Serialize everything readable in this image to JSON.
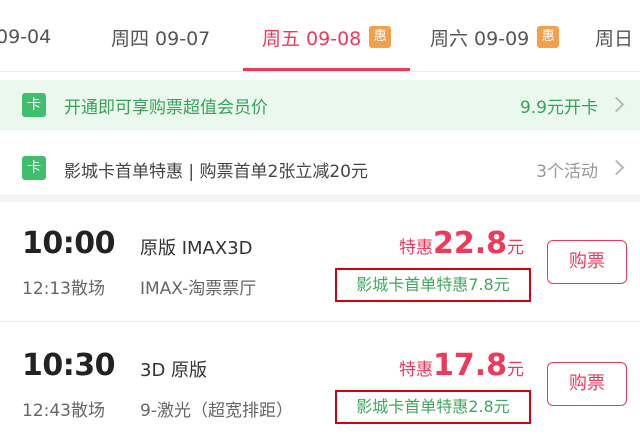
{
  "date_tabs": [
    {
      "label": "09-04",
      "badge": ""
    },
    {
      "label": "周四 09-07",
      "badge": ""
    },
    {
      "label": "周五 09-08",
      "badge": "惠"
    },
    {
      "label": "周六 09-09",
      "badge": "惠"
    },
    {
      "label": "周日",
      "badge": ""
    }
  ],
  "active_tab_index": 2,
  "colors": {
    "accent": "#f0395a",
    "green": "#3fbf6e",
    "badge": "#f2a14a",
    "highlight_box": "#d8000f"
  },
  "promos": [
    {
      "icon_label": "卡",
      "icon": "card-icon",
      "text": "开通即可享购票超值会员价",
      "right": "9.9元开卡"
    },
    {
      "icon_label": "卡",
      "icon": "card-icon",
      "text": "影城卡首单特惠 | 购票首单2张立减20元",
      "right": "3个活动"
    }
  ],
  "sessions": [
    {
      "start": "10:00",
      "end": "12:13散场",
      "version": "原版 IMAX3D",
      "hall": "IMAX-淘票票厅",
      "price_prefix": "特惠",
      "price": "22.8",
      "price_unit": "元",
      "discount": "影城卡首单特惠7.8元",
      "buy_label": "购票"
    },
    {
      "start": "10:30",
      "end": "12:43散场",
      "version": "3D 原版",
      "hall": "9-激光（超宽排距）",
      "price_prefix": "特惠",
      "price": "17.8",
      "price_unit": "元",
      "discount": "影城卡首单特惠2.8元",
      "buy_label": "购票"
    }
  ]
}
